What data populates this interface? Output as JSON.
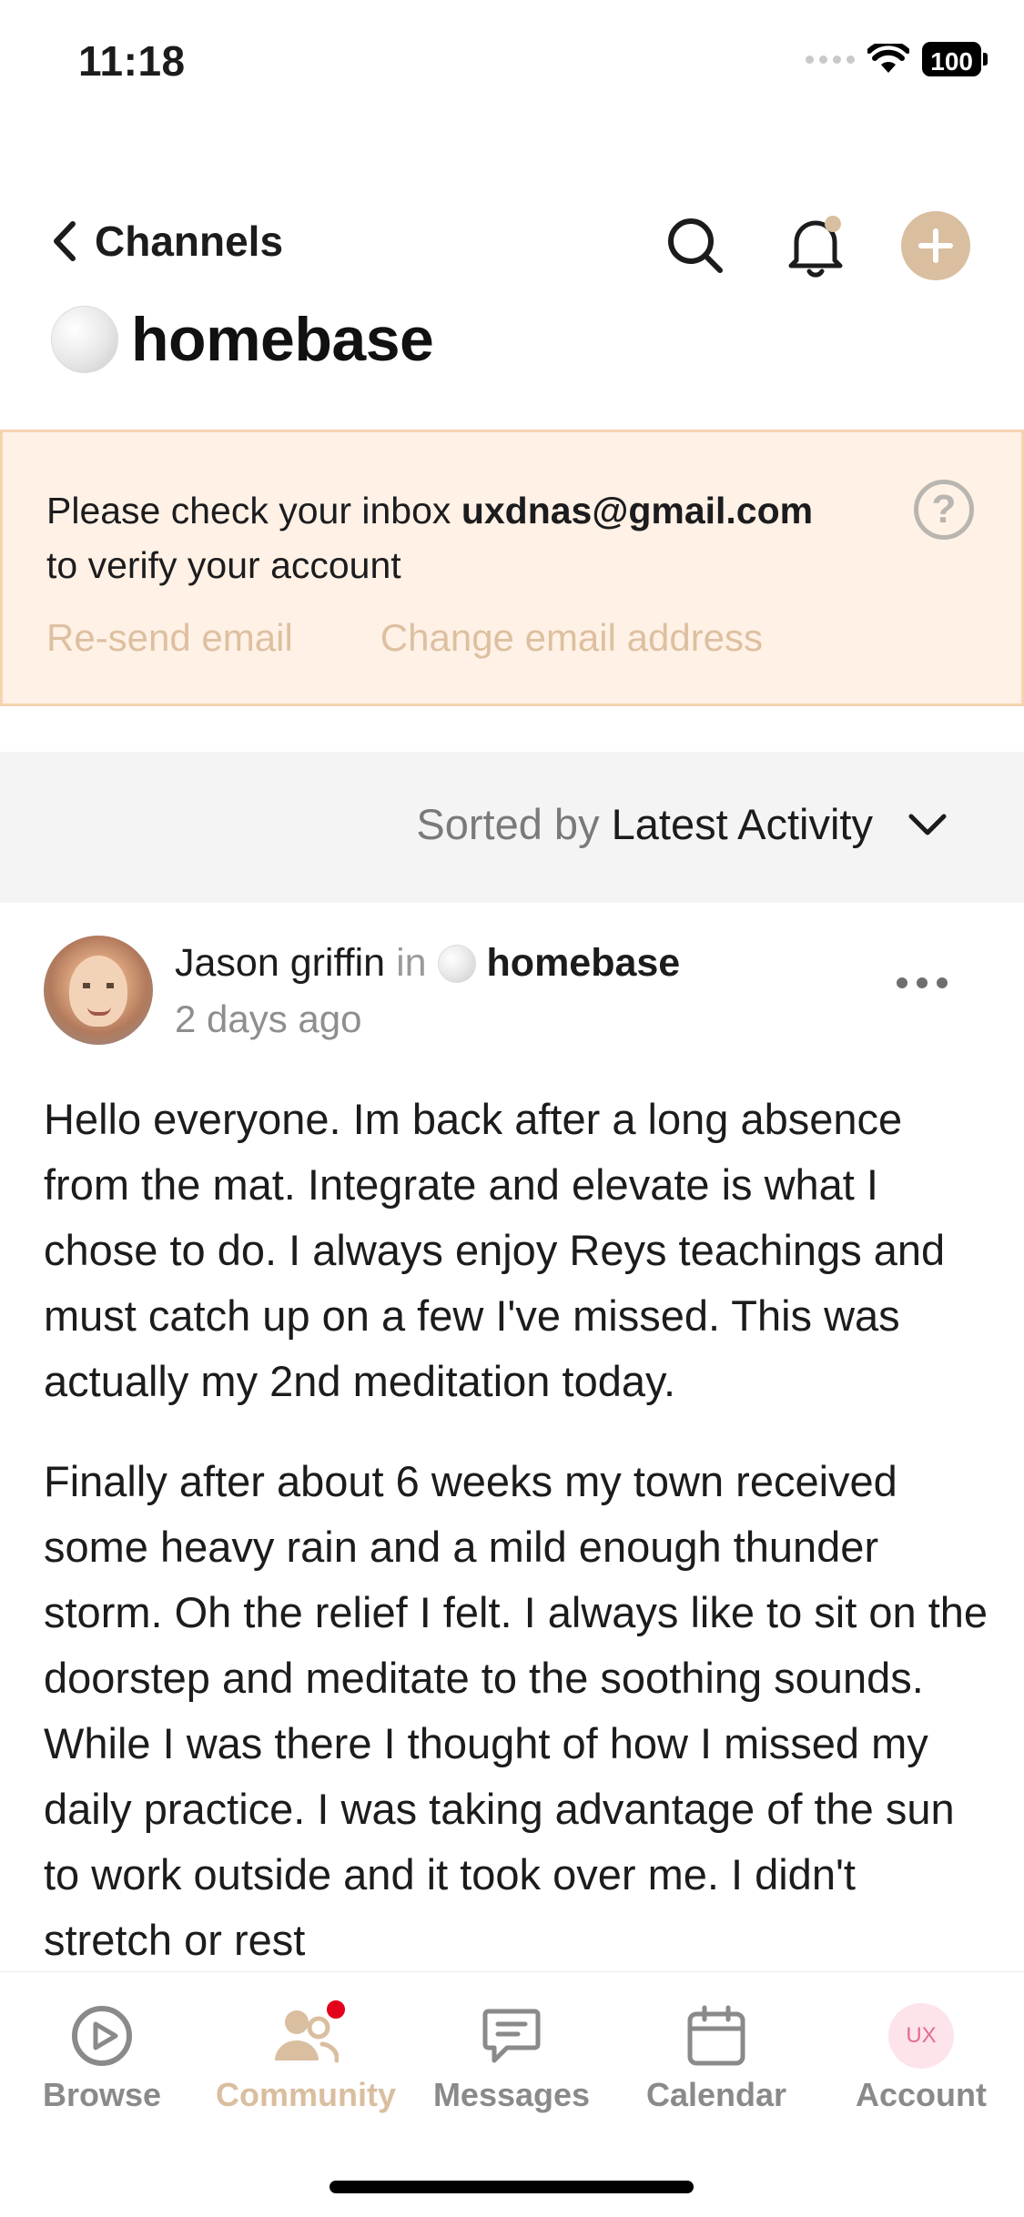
{
  "status_bar": {
    "time": "11:18",
    "battery": "100"
  },
  "header": {
    "back_label": "Channels",
    "channel_name": "homebase"
  },
  "verify_banner": {
    "message_prefix": "Please check your inbox ",
    "email": "uxdnas@gmail.com",
    "message_suffix": "to verify your account",
    "help": "?",
    "resend_label": "Re-send email",
    "change_label": "Change email address"
  },
  "sort": {
    "prefix": "Sorted by",
    "value": "Latest Activity"
  },
  "post": {
    "author": "Jason griffin",
    "in_word": "in",
    "channel": "homebase",
    "time": "2 days ago",
    "paragraphs": [
      "Hello everyone. Im back after a long absence from the mat. Integrate and elevate is what I chose to do. I always enjoy Reys teachings and must catch up on a few I've missed. This was actually my 2nd meditation today.",
      "Finally after about 6 weeks my town received some heavy rain and a mild enough thunder storm. Oh the relief I felt. I always like to sit on the doorstep and meditate to the soothing sounds. While I was there I thought of how I missed my daily practice. I was taking advantage of the sun to work outside and it took over me. I didn't stretch or rest"
    ]
  },
  "tabs": {
    "browse": "Browse",
    "community": "Community",
    "messages": "Messages",
    "calendar": "Calendar",
    "account": "Account",
    "account_initials": "UX"
  },
  "colors": {
    "accent": "#d9be9f",
    "banner_bg": "#fff1e6",
    "banner_border": "#f6d3b0",
    "badge": "#e3001b"
  }
}
